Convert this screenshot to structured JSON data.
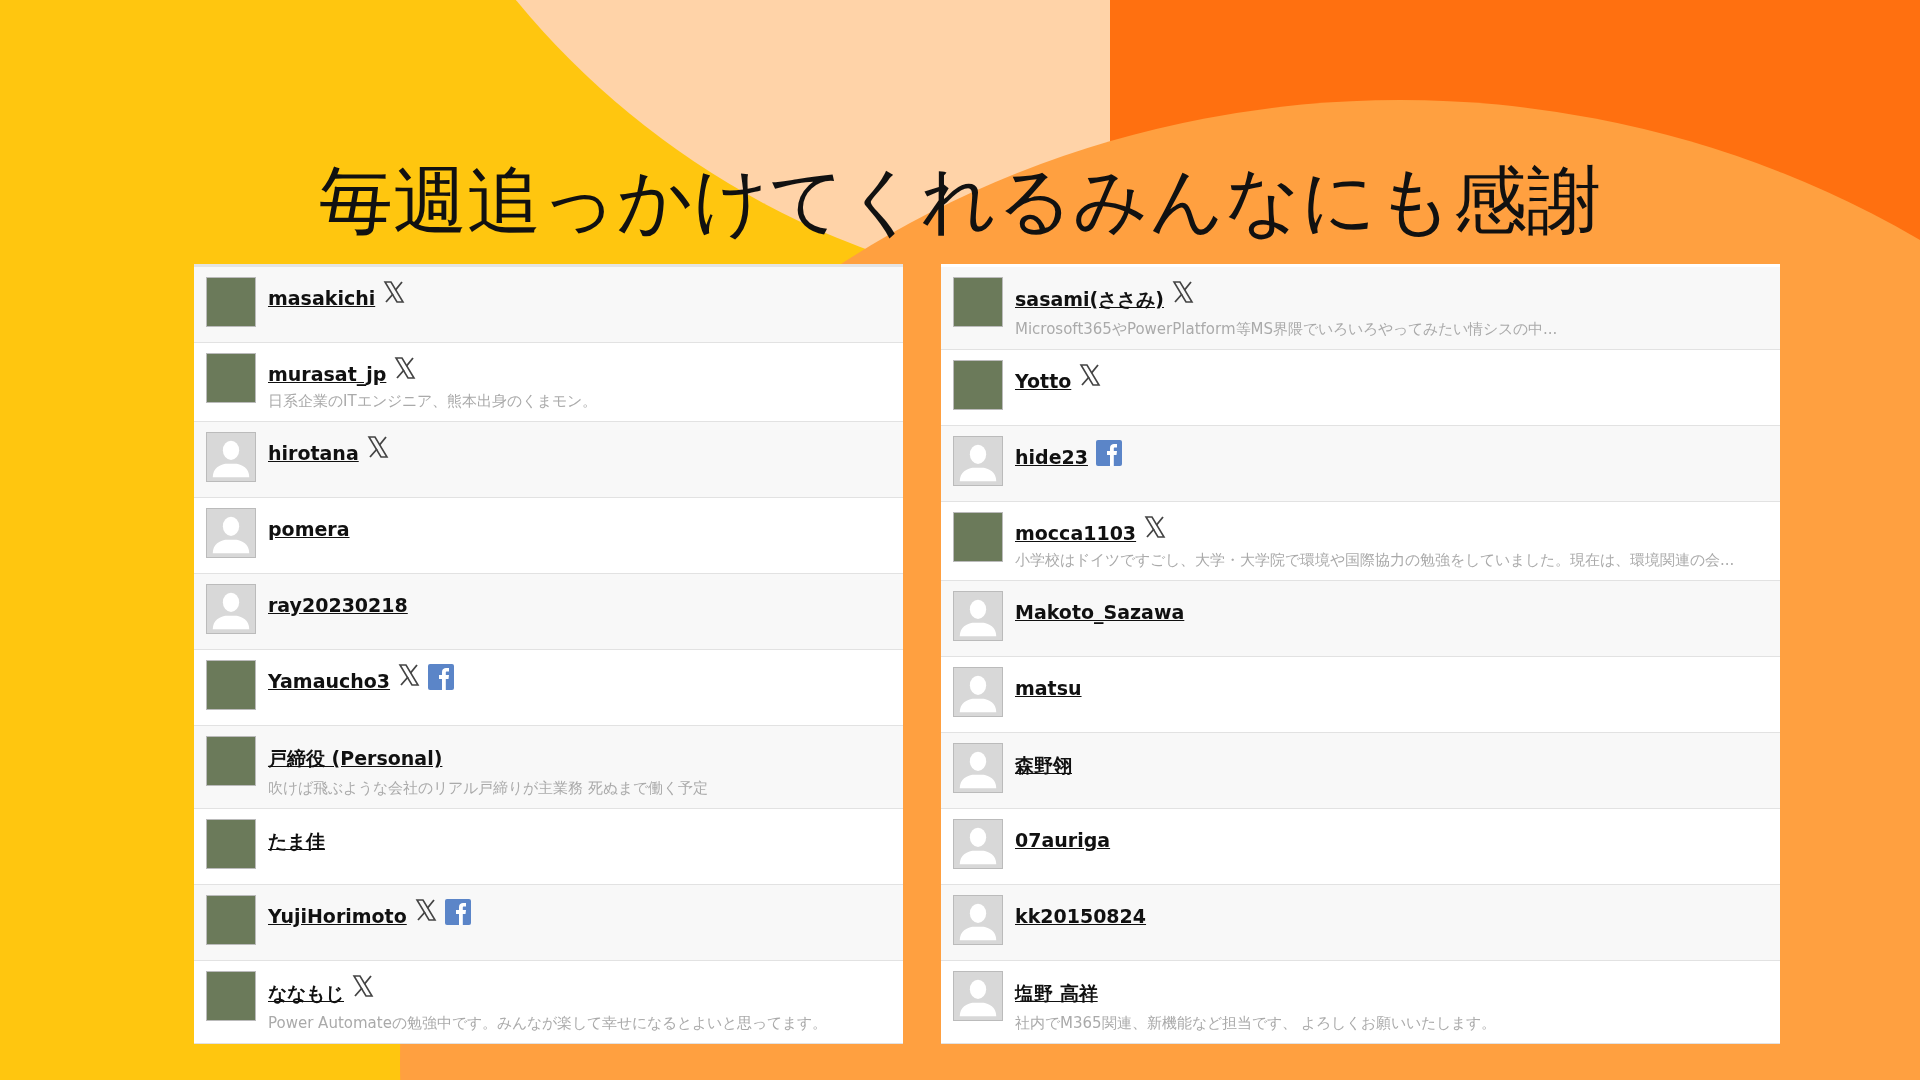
{
  "title": "毎週追っかけてくれるみんなにも感謝",
  "columns": [
    {
      "members": [
        {
          "name": "masakichi",
          "photo": true,
          "x": true
        },
        {
          "name": "murasat_jp",
          "photo": true,
          "x": true,
          "bio": "日系企業のITエンジニア、熊本出身のくまモン。"
        },
        {
          "name": "hirotana",
          "photo": false,
          "x": true
        },
        {
          "name": "pomera",
          "photo": false
        },
        {
          "name": "ray20230218",
          "photo": false
        },
        {
          "name": "Yamaucho3",
          "photo": true,
          "x": true,
          "facebook": true
        },
        {
          "name": "戸締役 (Personal)",
          "photo": true,
          "bio": "吹けば飛ぶような会社のリアル戸締りが主業務 死ぬまで働く予定"
        },
        {
          "name": "たま佳",
          "photo": true
        },
        {
          "name": "YujiHorimoto",
          "photo": true,
          "x": true,
          "facebook": true
        },
        {
          "name": "ななもじ",
          "photo": true,
          "x": true,
          "bio": "Power Automateの勉強中です。みんなが楽して幸せになるとよいと思ってます。"
        }
      ]
    },
    {
      "members": [
        {
          "name": "sasami(ささみ)",
          "photo": true,
          "x": true,
          "bio": "Microsoft365やPowerPlatform等MS界隈でいろいろやってみたい情シスの中..."
        },
        {
          "name": "Yotto",
          "photo": true,
          "x": true
        },
        {
          "name": "hide23",
          "photo": false,
          "facebook": true
        },
        {
          "name": "mocca1103",
          "photo": true,
          "x": true,
          "bio": "小学校はドイツですごし、大学・大学院で環境や国際協力の勉強をしていました。現在は、環境関連の会..."
        },
        {
          "name": "Makoto_Sazawa",
          "photo": false
        },
        {
          "name": "matsu",
          "photo": false
        },
        {
          "name": "森野翎",
          "photo": false
        },
        {
          "name": "07auriga",
          "photo": false
        },
        {
          "name": "kk20150824",
          "photo": false
        },
        {
          "name": "塩野 高祥",
          "photo": false,
          "bio": "社内でM365関連、新機能など担当です、 よろしくお願いいたします。"
        }
      ]
    }
  ]
}
